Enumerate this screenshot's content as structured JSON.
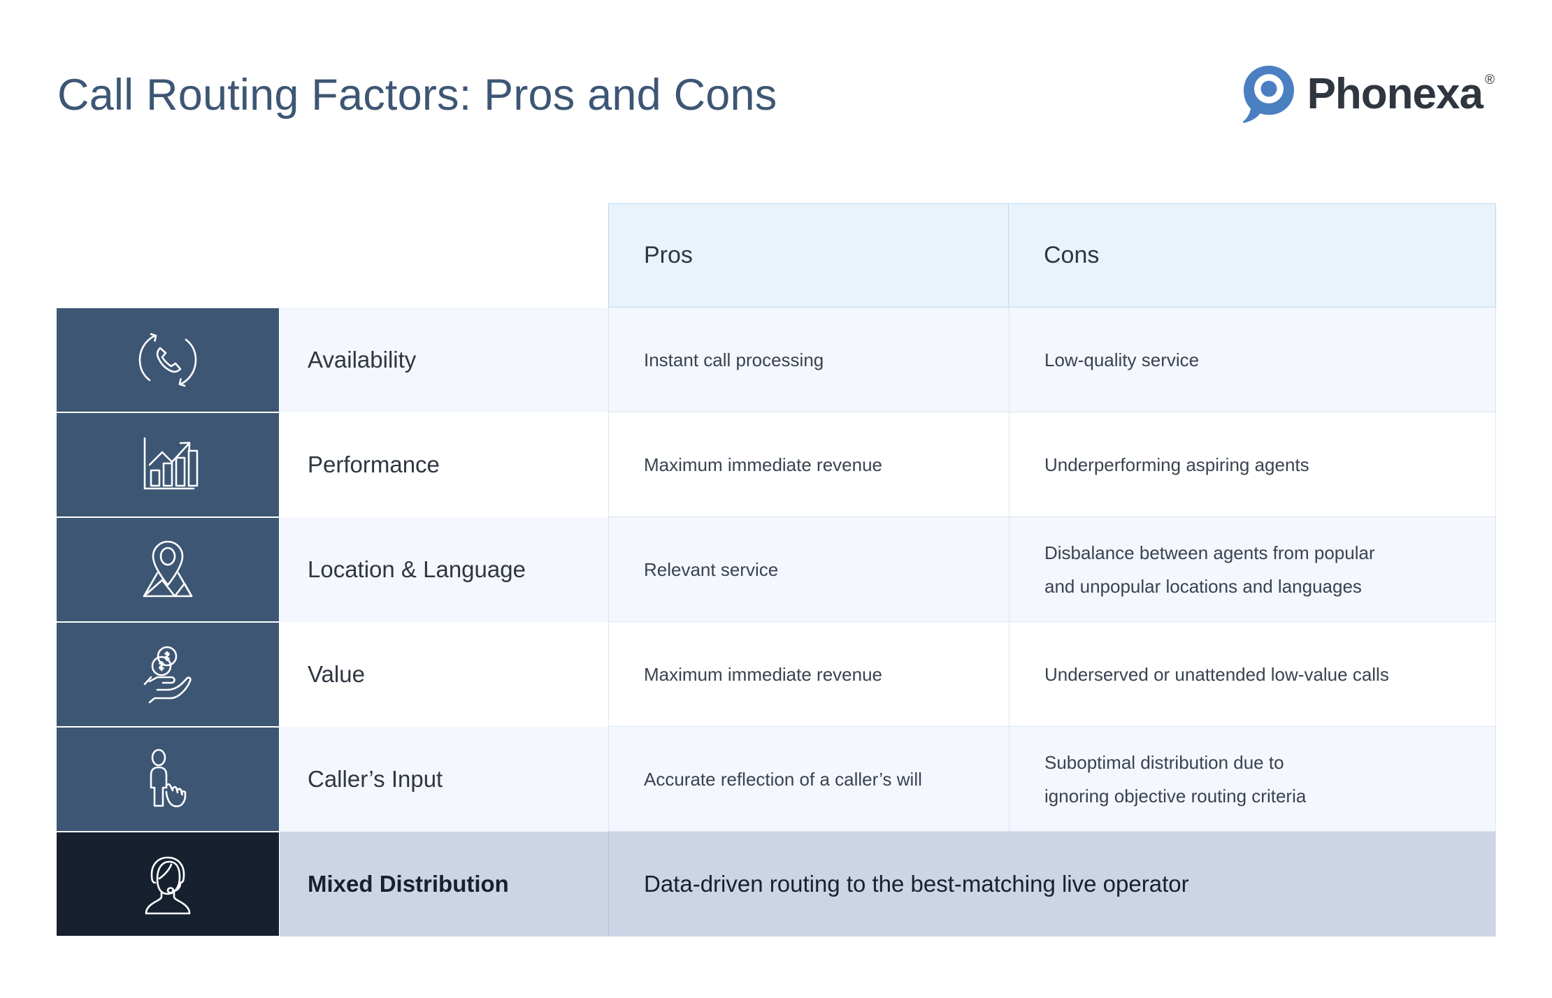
{
  "header": {
    "title": "Call Routing Factors: Pros and Cons",
    "brand_name": "Phonexa",
    "brand_registered": "®",
    "brand_icon": "phonexa-pin-logo-icon",
    "title_color": "#3d5674",
    "brand_color": "#4a7fc1"
  },
  "table": {
    "columns": {
      "factor_header": "",
      "pros_header": "Pros",
      "cons_header": "Cons"
    },
    "rows": [
      {
        "icon": "phone-rotating-arrows-icon",
        "factor": "Availability",
        "pros": "Instant call processing",
        "cons_lines": [
          "Low-quality service"
        ]
      },
      {
        "icon": "bar-chart-growth-arrow-icon",
        "factor": "Performance",
        "pros": "Maximum immediate revenue",
        "cons_lines": [
          "Underperforming aspiring agents"
        ]
      },
      {
        "icon": "map-pin-location-icon",
        "factor": "Location & Language",
        "pros": "Relevant  service",
        "cons_lines": [
          "Disbalance between agents from popular",
          "and unpopular locations and languages"
        ]
      },
      {
        "icon": "hand-holding-money-coins-icon",
        "factor": "Value",
        "pros": "Maximum immediate revenue",
        "cons_lines": [
          "Underserved or unattended low-value calls"
        ]
      },
      {
        "icon": "person-pointing-hand-icon",
        "factor": "Caller’s Input",
        "pros": "Accurate reflection of a caller’s will",
        "cons_lines": [
          "Suboptimal distribution due to",
          "ignoring objective routing criteria"
        ]
      }
    ],
    "final_row": {
      "icon": "headset-support-agent-icon",
      "factor": "Mixed Distribution",
      "merged_text": "Data-driven routing to the best-matching live operator"
    },
    "colors": {
      "icon_cell": "#3d5674",
      "icon_cell_accent": "#16202f",
      "header_band": "#e9f3fc",
      "row_shade": "#f4f7fd",
      "final_row": "#ccd4e6",
      "grid_line": "#dbe6f3"
    }
  }
}
